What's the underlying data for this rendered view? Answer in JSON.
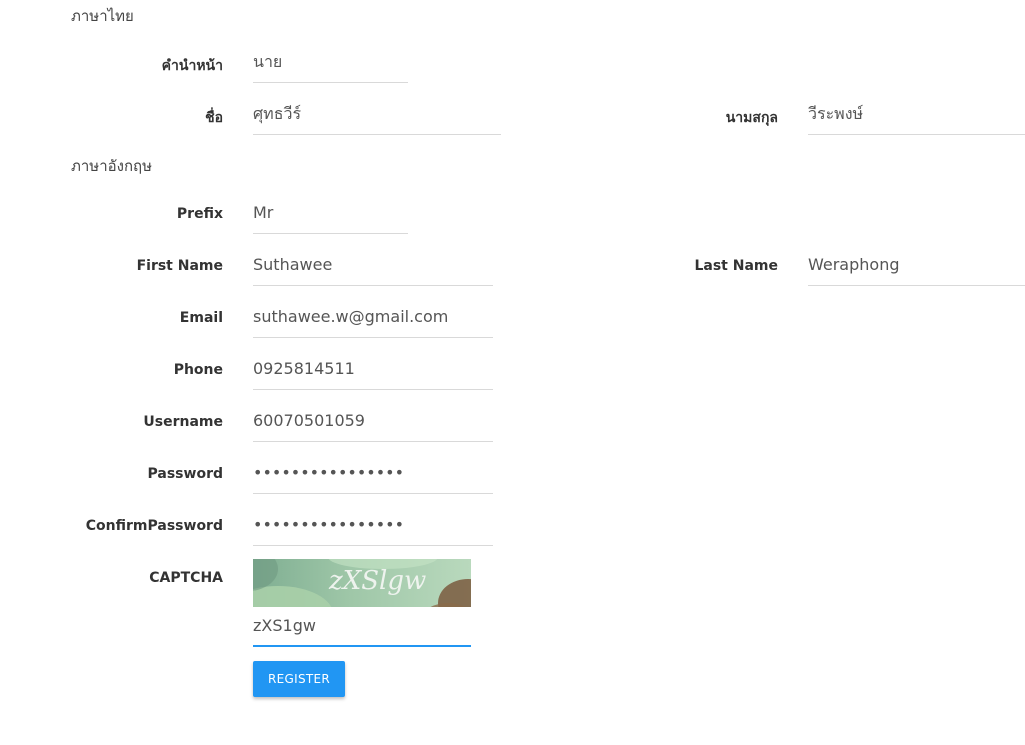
{
  "thai_section": {
    "title": "ภาษาไทย",
    "prefix_label": "คำนำหน้า",
    "prefix_value": "นาย",
    "first_name_label": "ชื่อ",
    "first_name_value": "ศุทธวีร์",
    "last_name_label": "นามสกุล",
    "last_name_value": "วีระพงษ์"
  },
  "english_section": {
    "title": "ภาษาอังกฤษ",
    "prefix_label": "Prefix",
    "prefix_value": "Mr",
    "first_name_label": "First Name",
    "first_name_value": "Suthawee",
    "last_name_label": "Last Name",
    "last_name_value": "Weraphong",
    "email_label": "Email",
    "email_value": "suthawee.w@gmail.com",
    "phone_label": "Phone",
    "phone_value": "0925814511",
    "username_label": "Username",
    "username_value": "60070501059",
    "password_label": "Password",
    "password_value": "••••••••••••••••",
    "confirm_password_label": "ConfirmPassword",
    "confirm_password_value": "••••••••••••••••",
    "captcha_label": "CAPTCHA",
    "captcha_image_text": "zXSlgw",
    "captcha_input_value": "zXS1gw"
  },
  "register_button": "REGISTER",
  "colors": {
    "accent": "#2196f3",
    "underline": "#d9d9d9"
  }
}
